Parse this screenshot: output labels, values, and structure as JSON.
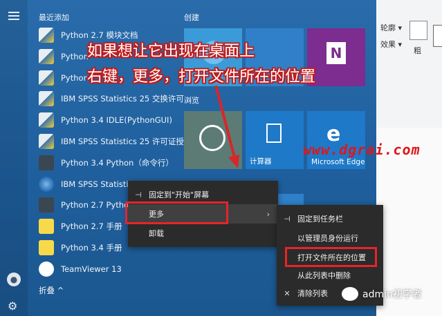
{
  "start_menu": {
    "recent_label": "最近添加",
    "create_label": "创建",
    "browse_label": "浏览",
    "collapse_label": "折叠 ^",
    "apps": [
      {
        "label": "Python 2.7 模块文档",
        "icon": "python-doc-icon",
        "kind": "py"
      },
      {
        "label": "Python",
        "icon": "python-icon",
        "kind": "py"
      },
      {
        "label": "Python",
        "icon": "python-icon",
        "kind": "py"
      },
      {
        "label": "IBM SPSS Statistics 25 交换许可...",
        "icon": "spss-icon",
        "kind": "py"
      },
      {
        "label": "Python 3.4 IDLE(PythonGUI)",
        "icon": "python-idle-icon",
        "kind": "py"
      },
      {
        "label": "IBM SPSS Statistics 25 许可证授...",
        "icon": "spss-license-icon",
        "kind": "py"
      },
      {
        "label": "Python 3.4 Python（命令行）",
        "icon": "python-console-icon",
        "kind": "pyc"
      },
      {
        "label": "IBM SPSS Statistics",
        "icon": "spss-icon",
        "kind": "spss"
      },
      {
        "label": "Python 2.7 Python",
        "icon": "python-console-icon",
        "kind": "pyc"
      },
      {
        "label": "Python 2.7 手册",
        "icon": "help-icon",
        "kind": "help"
      },
      {
        "label": "Python 3.4 手册",
        "icon": "help-icon",
        "kind": "help"
      },
      {
        "label": "TeamViewer 13",
        "icon": "teamviewer-icon",
        "kind": "tv"
      }
    ]
  },
  "tiles": {
    "calculator": "计算器",
    "edge": "Microsoft Edge"
  },
  "annotation": {
    "line1": "如果想让它出现在桌面上",
    "line2": "右键，更多，打开文件所在的位置"
  },
  "watermark": "www.dgrai.com",
  "context_menu": {
    "pin_start": "固定到\"开始\"屏幕",
    "more": "更多",
    "uninstall": "卸载"
  },
  "submenu": {
    "pin_taskbar": "固定到任务栏",
    "run_admin": "以管理员身份运行",
    "open_location": "打开文件所在的位置",
    "remove_list": "从此列表中删除",
    "clear_list": "清除列表"
  },
  "ribbon": {
    "item1": "轮廓 ▾",
    "item2": "效果 ▾",
    "item3": "粗"
  },
  "wechat_caption": "admin初学者",
  "colors": {
    "start_bg": "#1f5f9d",
    "highlight_red": "#e8242a",
    "menu_bg": "#2b2b2b"
  }
}
